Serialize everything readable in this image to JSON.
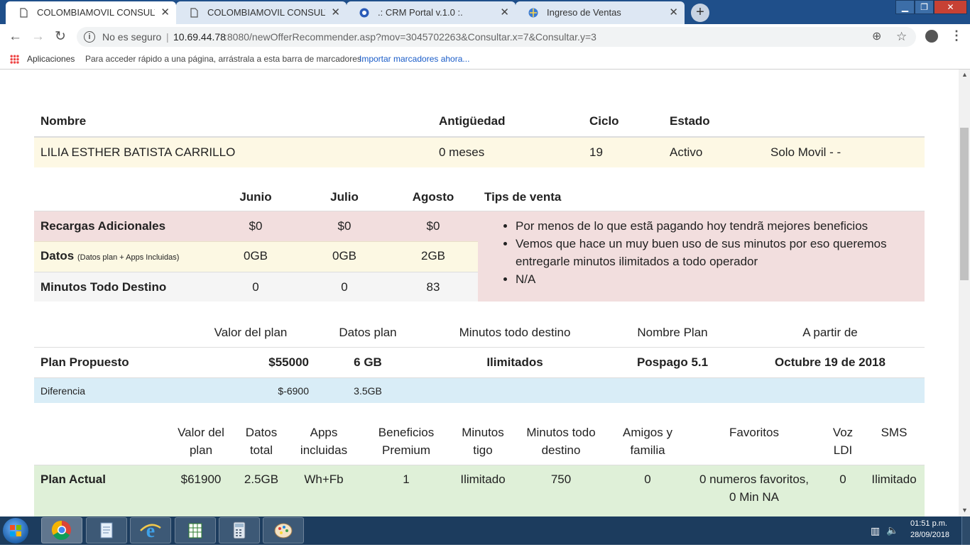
{
  "browser": {
    "tabs": [
      {
        "title": "COLOMBIAMOVIL CONSULTA IN",
        "active": true
      },
      {
        "title": "COLOMBIAMOVIL CONSULTA IN",
        "active": false
      },
      {
        "title": ".: CRM Portal v.1.0 :.",
        "active": false
      },
      {
        "title": "Ingreso de Ventas",
        "active": false
      }
    ],
    "security_text": "No es seguro",
    "url_host": "10.69.44.78",
    "url_rest": ":8080/newOfferRecommender.asp?mov=3045702263&Consultar.x=7&Consultar.y=3",
    "bookmarks_apps": "Aplicaciones",
    "bookmarks_hint": "Para acceder rápido a una página, arrástrala a esta barra de marcadores.",
    "bookmarks_import": "Importar marcadores ahora..."
  },
  "customer": {
    "headers": {
      "name": "Nombre",
      "antiguedad": "Antigüedad",
      "ciclo": "Ciclo",
      "estado": "Estado"
    },
    "name": "LILIA ESTHER BATISTA CARRILLO",
    "antiguedad": "0 meses",
    "ciclo": "19",
    "estado": "Activo",
    "tipo": "Solo Movil - -"
  },
  "usage": {
    "months": [
      "Junio",
      "Julio",
      "Agosto"
    ],
    "tips_header": "Tips de venta",
    "rows": [
      {
        "label": "Recargas Adicionales",
        "sub": "",
        "values": [
          "$0",
          "$0",
          "$0"
        ]
      },
      {
        "label": "Datos",
        "sub": "(Datos plan + Apps Incluidas)",
        "values": [
          "0GB",
          "0GB",
          "2GB"
        ]
      },
      {
        "label": "Minutos Todo Destino",
        "sub": "",
        "values": [
          "0",
          "0",
          "83"
        ]
      }
    ],
    "tips": [
      "Por menos de lo que estã pagando hoy tendrã mejores beneficios",
      "Vemos que hace un muy buen uso de sus minutos por eso queremos entregarle minutos ilimitados a todo operador",
      "N/A"
    ]
  },
  "proposed": {
    "headers": {
      "valor": "Valor del plan",
      "datos": "Datos plan",
      "minutos": "Minutos todo destino",
      "nombre": "Nombre Plan",
      "desde": "A partir de"
    },
    "label": "Plan Propuesto",
    "valor": "$55000",
    "datos": "6 GB",
    "minutos": "Ilimitados",
    "nombre": "Pospago 5.1",
    "desde": "Octubre 19 de 2018",
    "diff_label": "Diferencia",
    "diff_valor": "$-6900",
    "diff_datos": "3.5GB"
  },
  "current": {
    "headers": {
      "valor": [
        "Valor del",
        "plan"
      ],
      "datos": [
        "Datos",
        "total"
      ],
      "apps": [
        "Apps",
        "incluidas"
      ],
      "beneficios": [
        "Beneficios",
        "Premium"
      ],
      "min_tigo": [
        "Minutos",
        "tigo"
      ],
      "min_todo": [
        "Minutos todo",
        "destino"
      ],
      "amigos": [
        "Amigos y",
        "familia"
      ],
      "favoritos": "Favoritos",
      "voz": [
        "Voz",
        "LDI"
      ],
      "sms": "SMS"
    },
    "label": "Plan Actual",
    "valor": "$61900",
    "datos": "2.5GB",
    "apps": "Wh+Fb",
    "beneficios": "1",
    "min_tigo": "Ilimitado",
    "min_todo": "750",
    "amigos": "0",
    "favoritos": [
      "0 numeros favoritos,",
      "0 Min NA"
    ],
    "voz": "0",
    "sms": "Ilimitado"
  },
  "taskbar": {
    "time": "01:51 p.m.",
    "date": "28/09/2018"
  },
  "colors": {
    "customer_row": "#fdf8e4",
    "usage_pink": "#f2dede",
    "usage_yellow": "#fcf8e3",
    "usage_gray": "#f5f5f5",
    "diff_blue": "#d9edf7",
    "current_green": "#dff0d8"
  }
}
